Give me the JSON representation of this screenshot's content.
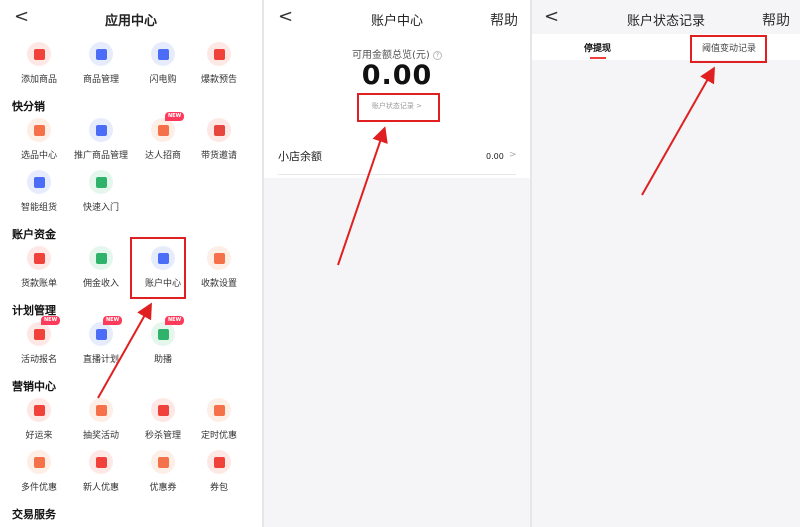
{
  "app_center": {
    "title": "应用中心",
    "back_glyph": "<",
    "top_items": [
      {
        "label": "添加商品",
        "icon": "add-product-icon",
        "bg": "#fde8e6",
        "fg": "#f0413a"
      },
      {
        "label": "商品管理",
        "icon": "product-manage-icon",
        "bg": "#e7ecfd",
        "fg": "#4a6cf7"
      },
      {
        "label": "闪电购",
        "icon": "lightning-buy-icon",
        "bg": "#e7ecfd",
        "fg": "#4a6cf7"
      },
      {
        "label": "爆款预告",
        "icon": "hot-preview-icon",
        "bg": "#fde8e6",
        "fg": "#f0413a"
      }
    ],
    "sections": [
      {
        "title": "快分销",
        "items": [
          {
            "label": "选品中心",
            "icon": "selection-center-icon",
            "bg": "#fdeee6",
            "fg": "#f5714a",
            "badge": ""
          },
          {
            "label": "推广商品管理",
            "icon": "promo-manage-icon",
            "bg": "#e7ecfd",
            "fg": "#4a6cf7",
            "badge": ""
          },
          {
            "label": "达人招商",
            "icon": "influencer-icon",
            "bg": "#fdeee6",
            "fg": "#f5714a",
            "badge": "NEW"
          },
          {
            "label": "带货邀请",
            "icon": "invite-icon",
            "bg": "#fde8e6",
            "fg": "#e5473e",
            "badge": ""
          },
          {
            "label": "智能组货",
            "icon": "smart-group-icon",
            "bg": "#e7ecfd",
            "fg": "#4a6cf7",
            "badge": ""
          },
          {
            "label": "快速入门",
            "icon": "quick-start-icon",
            "bg": "#e5f6ec",
            "fg": "#2fb36a",
            "badge": ""
          }
        ]
      },
      {
        "title": "账户资金",
        "items": [
          {
            "label": "货款账单",
            "icon": "bill-icon",
            "bg": "#fde8e6",
            "fg": "#f0413a",
            "badge": ""
          },
          {
            "label": "佣金收入",
            "icon": "commission-icon",
            "bg": "#e5f6ec",
            "fg": "#2fb36a",
            "badge": ""
          },
          {
            "label": "账户中心",
            "icon": "account-center-icon",
            "bg": "#e7ecfd",
            "fg": "#4a6cf7",
            "badge": ""
          },
          {
            "label": "收款设置",
            "icon": "payment-settings-icon",
            "bg": "#fdeee6",
            "fg": "#f5714a",
            "badge": ""
          }
        ]
      },
      {
        "title": "计划管理",
        "items": [
          {
            "label": "活动报名",
            "icon": "activity-signup-icon",
            "bg": "#fde8e6",
            "fg": "#f0413a",
            "badge": "NEW"
          },
          {
            "label": "直播计划",
            "icon": "live-plan-icon",
            "bg": "#e7ecfd",
            "fg": "#4a6cf7",
            "badge": "NEW"
          },
          {
            "label": "助播",
            "icon": "assist-live-icon",
            "bg": "#e5f6ec",
            "fg": "#2fb36a",
            "badge": "NEW"
          }
        ]
      },
      {
        "title": "营销中心",
        "items": [
          {
            "label": "好运来",
            "icon": "good-luck-icon",
            "bg": "#fde8e6",
            "fg": "#f0413a",
            "badge": ""
          },
          {
            "label": "抽奖活动",
            "icon": "lottery-icon",
            "bg": "#fdeee6",
            "fg": "#f5714a",
            "badge": ""
          },
          {
            "label": "秒杀管理",
            "icon": "flash-sale-icon",
            "bg": "#fde8e6",
            "fg": "#f0413a",
            "badge": ""
          },
          {
            "label": "定时优惠",
            "icon": "timed-discount-icon",
            "bg": "#fdeee6",
            "fg": "#f5714a",
            "badge": ""
          },
          {
            "label": "多件优惠",
            "icon": "multi-discount-icon",
            "bg": "#fdeee6",
            "fg": "#f5714a",
            "badge": ""
          },
          {
            "label": "新人优惠",
            "icon": "newcomer-discount-icon",
            "bg": "#fde8e6",
            "fg": "#f0413a",
            "badge": ""
          },
          {
            "label": "优惠券",
            "icon": "coupon-icon",
            "bg": "#fdeee6",
            "fg": "#f5714a",
            "badge": ""
          },
          {
            "label": "券包",
            "icon": "coupon-pack-icon",
            "bg": "#fde8e6",
            "fg": "#f0413a",
            "badge": ""
          }
        ]
      },
      {
        "title": "交易服务",
        "items": []
      }
    ]
  },
  "account_center": {
    "title": "账户中心",
    "help": "帮助",
    "balance_label": "可用金额总览(元)",
    "info_glyph": "?",
    "balance_value": "0.00",
    "status_link": "账户状态记录",
    "status_link_arrow": ">",
    "shop_balance_label": "小店余额",
    "shop_balance_value": "0.00",
    "row_arrow": ">"
  },
  "account_status": {
    "title": "账户状态记录",
    "help": "帮助",
    "tabs": [
      "停提现",
      "阈值变动记录"
    ]
  },
  "colors": {
    "annotation_red": "#e02020",
    "tab_underline": "#f0413a"
  }
}
